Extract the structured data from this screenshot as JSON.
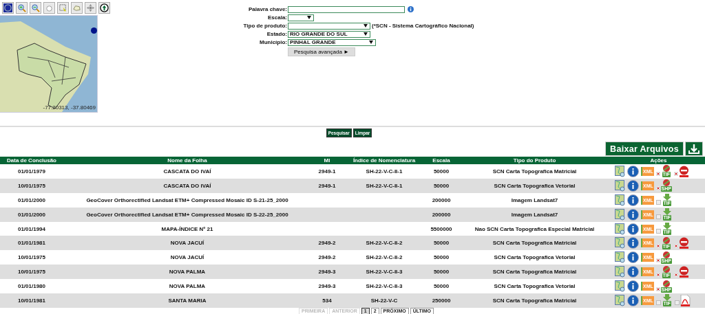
{
  "map": {
    "coordinates": "-77.20313, -37.80469"
  },
  "search_form": {
    "fields": [
      {
        "label": "Palavra chave:",
        "kind": "text"
      },
      {
        "label": "Escala:",
        "kind": "select"
      },
      {
        "label": "Tipo de produto:",
        "kind": "select",
        "note": "(*SCN - Sistema Cartográfico Nacional)"
      },
      {
        "label": "Estado:",
        "kind": "select",
        "value": "RIO GRANDE DO SUL"
      },
      {
        "label": "Município:",
        "kind": "select",
        "value": "PINHAL GRANDE"
      }
    ],
    "advanced_button": "Pesquisa avançada ►"
  },
  "buttons": [
    "Pesquisar",
    "Limpar"
  ],
  "download_button": "Baixar Arquivos",
  "table": {
    "columns": [
      "Data de Conclusão",
      "Nome da Folha",
      "MI",
      "Índice de Nomenclatura",
      "Escala",
      "Tipo do Produto",
      "Ações"
    ],
    "rows": [
      {
        "date": "01/01/1979",
        "name": "CASCATA DO IVAÍ",
        "mi": "2949-1",
        "index": "SH-22-V-C-II-1",
        "scale": "50000",
        "type": "SCN Carta Topografica Matricial",
        "xml": "XML",
        "downloads": [
          {
            "kind": "raster",
            "label": "TIF",
            "available": false
          },
          {
            "kind": "pdf",
            "available": false
          }
        ]
      },
      {
        "date": "10/01/1975",
        "name": "CASCATA DO IVAÍ",
        "mi": "2949-1",
        "index": "SH-22-V-C-II-1",
        "scale": "50000",
        "type": "SCN Carta Topografica Vetorial",
        "xml": "XML",
        "downloads": [
          {
            "kind": "raster",
            "label": "SHP",
            "available": false
          }
        ]
      },
      {
        "date": "01/01/2000",
        "name": "GeoCover Orthorectified Landsat ETM+ Compressed Mosaic ID S-21-25_2000",
        "scale": "200000",
        "type": "Imagem Landsat7",
        "xml": "XML",
        "downloads": [
          {
            "kind": "raster",
            "label": "TIF",
            "available": true
          }
        ]
      },
      {
        "date": "01/01/2000",
        "name": "GeoCover Orthorectified Landsat ETM+ Compressed Mosaic ID S-22-25_2000",
        "scale": "200000",
        "type": "Imagem Landsat7",
        "xml": "XML",
        "downloads": [
          {
            "kind": "raster",
            "label": "TIF",
            "available": true
          }
        ]
      },
      {
        "date": "01/01/1994",
        "name": "MAPA-ÍNDICE Nº 21",
        "scale": "5500000",
        "type": "Nao SCN Carta Topografica Especial Matricial",
        "xml": "XML",
        "downloads": [
          {
            "kind": "raster",
            "label": "TIF",
            "available": true
          }
        ]
      },
      {
        "date": "01/01/1981",
        "name": "NOVA JACUÍ",
        "mi": "2949-2",
        "index": "SH-22-V-C-II-2",
        "scale": "50000",
        "type": "SCN Carta Topografica Matricial",
        "xml": "XML",
        "downloads": [
          {
            "kind": "raster",
            "label": "TIF",
            "available": false
          },
          {
            "kind": "pdf",
            "available": false
          }
        ]
      },
      {
        "date": "10/01/1975",
        "name": "NOVA JACUÍ",
        "mi": "2949-2",
        "index": "SH-22-V-C-II-2",
        "scale": "50000",
        "type": "SCN Carta Topografica Vetorial",
        "xml": "XML",
        "downloads": [
          {
            "kind": "raster",
            "label": "SHP",
            "available": false
          }
        ]
      },
      {
        "date": "10/01/1975",
        "name": "NOVA PALMA",
        "mi": "2949-3",
        "index": "SH-22-V-C-II-3",
        "scale": "50000",
        "type": "SCN Carta Topografica Matricial",
        "xml": "XML",
        "downloads": [
          {
            "kind": "raster",
            "label": "TIF",
            "available": false
          },
          {
            "kind": "pdf",
            "available": false
          }
        ]
      },
      {
        "date": "01/01/1980",
        "name": "NOVA PALMA",
        "mi": "2949-3",
        "index": "SH-22-V-C-II-3",
        "scale": "50000",
        "type": "SCN Carta Topografica Vetorial",
        "xml": "XML",
        "downloads": [
          {
            "kind": "raster",
            "label": "SHP",
            "available": false
          }
        ]
      },
      {
        "date": "10/01/1981",
        "name": "SANTA MARIA",
        "mi": "534",
        "index": "SH-22-V-C",
        "scale": "250000",
        "type": "SCN Carta Topografica Matricial",
        "xml": "XML",
        "downloads": [
          {
            "kind": "raster",
            "label": "TIF",
            "available": true
          },
          {
            "kind": "pdf",
            "available": true
          }
        ]
      }
    ]
  },
  "pagination": [
    {
      "label": "PRIMEIRA",
      "disabled": true,
      "selected": false
    },
    {
      "label": "ANTERIOR",
      "disabled": true,
      "selected": false
    },
    {
      "label": "1",
      "disabled": false,
      "selected": true
    },
    {
      "label": "2",
      "disabled": false,
      "selected": false
    },
    {
      "label": "PRÓXIMO",
      "disabled": false,
      "selected": false
    },
    {
      "label": "ÚLTIMO",
      "disabled": false,
      "selected": false
    }
  ]
}
